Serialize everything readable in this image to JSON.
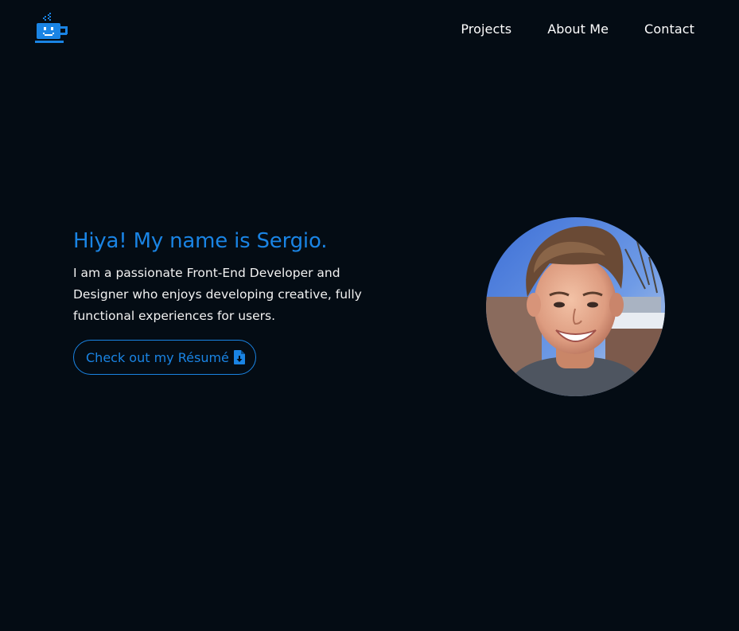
{
  "brand": {
    "logo_icon": "coffee-cup-smile-icon",
    "accent_color": "#1a84e4"
  },
  "nav": {
    "items": [
      {
        "label": "Projects"
      },
      {
        "label": "About Me"
      },
      {
        "label": "Contact"
      }
    ]
  },
  "hero": {
    "greeting": "Hiya! My name is Sergio.",
    "description": "I am a passionate Front-End Developer and Designer who enjoys developing creative, fully functional experiences for users.",
    "resume_button": {
      "label": "Check out my Résumé",
      "icon": "file-download-icon"
    }
  },
  "avatar": {
    "icon": "profile-photo"
  },
  "colors": {
    "background": "#040c14",
    "text": "#ffffff"
  }
}
